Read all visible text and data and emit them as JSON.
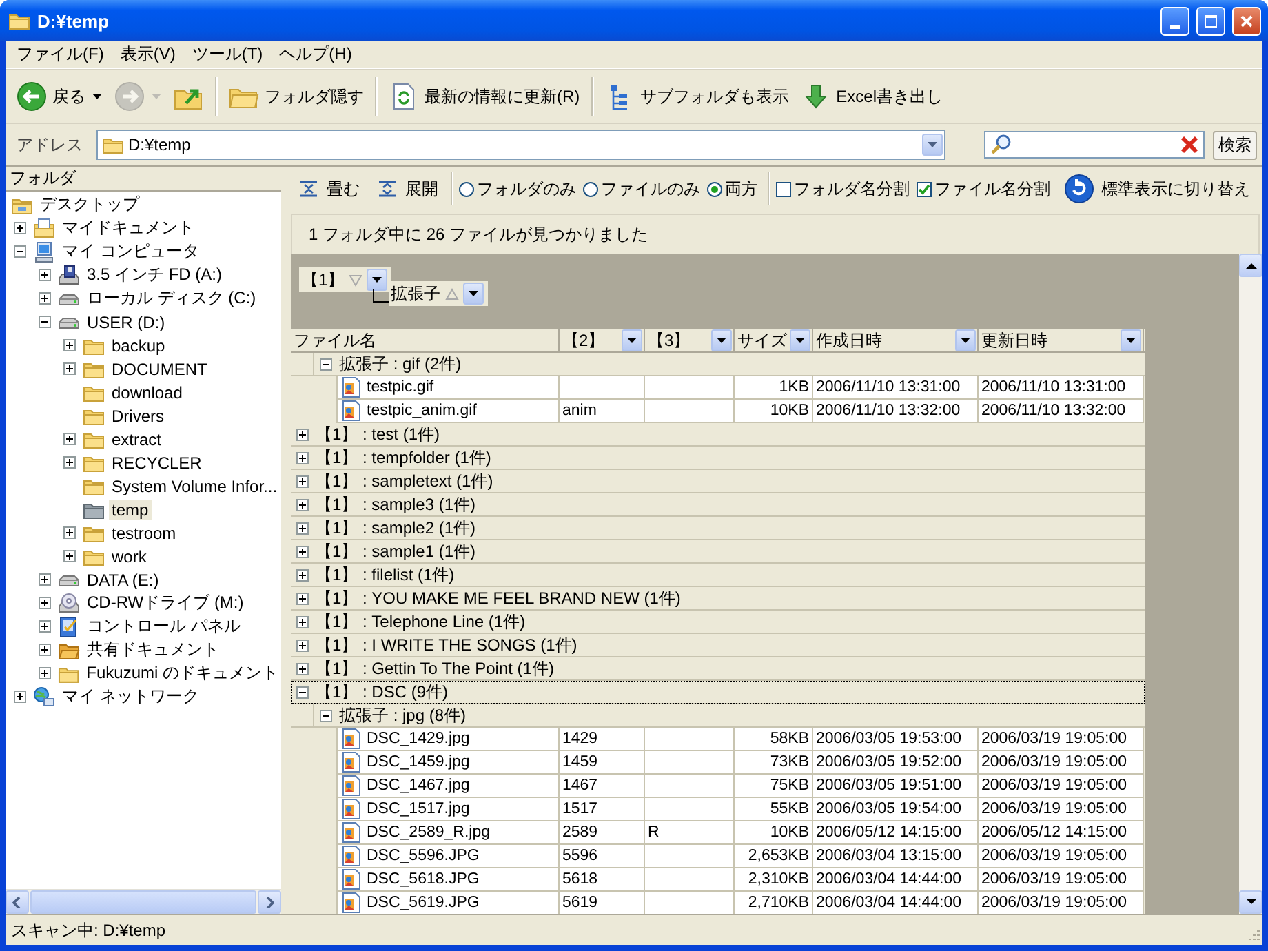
{
  "window": {
    "title": "D:¥temp"
  },
  "menu": [
    "ファイル(F)",
    "表示(V)",
    "ツール(T)",
    "ヘルプ(H)"
  ],
  "toolbar": [
    {
      "kind": "back",
      "label": "戻る",
      "dropdown": true,
      "disabled": false
    },
    {
      "kind": "forward",
      "dropdown": true,
      "disabled": true
    },
    {
      "kind": "up",
      "dropdown": false,
      "disabled": false
    },
    {
      "kind": "separator"
    },
    {
      "kind": "folders",
      "label": "フォルダ隠す",
      "dropdown": false,
      "disabled": false
    },
    {
      "kind": "separator"
    },
    {
      "kind": "refresh",
      "label": "最新の情報に更新(R)",
      "dropdown": false,
      "disabled": false
    },
    {
      "kind": "separator"
    },
    {
      "kind": "subfolders",
      "label": "サブフォルダも表示",
      "dropdown": false,
      "disabled": false
    },
    {
      "kind": "export",
      "label": "Excel書き出し",
      "dropdown": false,
      "disabled": false
    }
  ],
  "address": {
    "label": "アドレス",
    "value": "D:¥temp"
  },
  "search": {
    "button": "検索"
  },
  "folder_pane": {
    "title": "フォルダ",
    "tree": [
      {
        "label": "デスクトップ",
        "kind": "desktop",
        "selected": false,
        "children": [
          {
            "label": "マイドキュメント",
            "kind": "documents",
            "expanded": false,
            "selected": false
          },
          {
            "label": "マイ コンピュータ",
            "kind": "computer",
            "expanded": true,
            "selected": false,
            "children": [
              {
                "label": "3.5 インチ FD (A:)",
                "kind": "floppy",
                "expanded": false,
                "selected": false
              },
              {
                "label": "ローカル ディスク (C:)",
                "kind": "drive",
                "expanded": false,
                "selected": false
              },
              {
                "label": "USER (D:)",
                "kind": "drive",
                "expanded": true,
                "selected": false,
                "children": [
                  {
                    "label": "backup",
                    "kind": "folder",
                    "expanded": false,
                    "selected": false
                  },
                  {
                    "label": "DOCUMENT",
                    "kind": "folder",
                    "expanded": false,
                    "selected": false
                  },
                  {
                    "label": "download",
                    "kind": "folder",
                    "selected": false
                  },
                  {
                    "label": "Drivers",
                    "kind": "folder",
                    "selected": false
                  },
                  {
                    "label": "extract",
                    "kind": "folder",
                    "expanded": false,
                    "selected": false
                  },
                  {
                    "label": "RECYCLER",
                    "kind": "folder",
                    "expanded": false,
                    "selected": false
                  },
                  {
                    "label": "System Volume Infor...",
                    "kind": "folder",
                    "selected": false
                  },
                  {
                    "label": "temp",
                    "kind": "folder",
                    "selected": true
                  },
                  {
                    "label": "testroom",
                    "kind": "folder",
                    "expanded": false,
                    "selected": false
                  },
                  {
                    "label": "work",
                    "kind": "folder",
                    "expanded": false,
                    "selected": false
                  }
                ]
              },
              {
                "label": "DATA (E:)",
                "kind": "drive",
                "expanded": false,
                "selected": false
              },
              {
                "label": "CD-RWドライブ (M:)",
                "kind": "cdrom",
                "expanded": false,
                "selected": false
              },
              {
                "label": "コントロール パネル",
                "kind": "control-panel",
                "expanded": false,
                "selected": false
              },
              {
                "label": "共有ドキュメント",
                "kind": "shared",
                "expanded": false,
                "selected": false
              },
              {
                "label": "Fukuzumi のドキュメント",
                "kind": "folder",
                "expanded": false,
                "selected": false
              }
            ]
          },
          {
            "label": "マイ ネットワーク",
            "kind": "network",
            "expanded": false,
            "selected": false
          }
        ]
      }
    ]
  },
  "view_toolbar": {
    "actions": [
      {
        "kind": "collapse",
        "label": "畳む"
      },
      {
        "kind": "expand",
        "label": "展開"
      }
    ],
    "radios": [
      {
        "label": "フォルダのみ",
        "selected": false
      },
      {
        "label": "ファイルのみ",
        "selected": false
      },
      {
        "label": "両方",
        "selected": true
      }
    ],
    "checkboxes": [
      {
        "label": "フォルダ名分割",
        "checked": false
      },
      {
        "label": "ファイル名分割",
        "checked": true
      }
    ],
    "switch_button": "標準表示に切り替え"
  },
  "summary": "1 フォルダ中に 26 ファイルが見つかりました",
  "group_by": [
    {
      "label": "【1】",
      "descending": true
    },
    {
      "label": "拡張子",
      "descending": false
    }
  ],
  "grid": {
    "columns": [
      {
        "title": "ファイル名",
        "filter": false
      },
      {
        "title": "【2】",
        "filter": true
      },
      {
        "title": "【3】",
        "filter": true
      },
      {
        "title": "サイズ",
        "filter": true
      },
      {
        "title": "作成日時",
        "filter": true
      },
      {
        "title": "更新日時",
        "filter": true
      }
    ],
    "continued": [
      {
        "kind": "group",
        "label": "拡張子 : gif (2件)",
        "expanded": true,
        "focused": false,
        "children": [
          {
            "kind": "file",
            "name": "testpic.gif",
            "size": "1KB",
            "created": "2006/11/10 13:31:00",
            "modified": "2006/11/10 13:31:00"
          },
          {
            "kind": "file",
            "name": "testpic_anim.gif",
            "col2": "anim",
            "size": "10KB",
            "created": "2006/11/10 13:32:00",
            "modified": "2006/11/10 13:32:00"
          }
        ]
      }
    ],
    "rows": [
      {
        "kind": "group",
        "label": "【1】 : test (1件)",
        "expanded": false,
        "focused": false
      },
      {
        "kind": "group",
        "label": "【1】 : tempfolder (1件)",
        "expanded": false,
        "focused": false
      },
      {
        "kind": "group",
        "label": "【1】 : sampletext (1件)",
        "expanded": false,
        "focused": false
      },
      {
        "kind": "group",
        "label": "【1】 : sample3 (1件)",
        "expanded": false,
        "focused": false
      },
      {
        "kind": "group",
        "label": "【1】 : sample2 (1件)",
        "expanded": false,
        "focused": false
      },
      {
        "kind": "group",
        "label": "【1】 : sample1 (1件)",
        "expanded": false,
        "focused": false
      },
      {
        "kind": "group",
        "label": "【1】 : filelist (1件)",
        "expanded": false,
        "focused": false
      },
      {
        "kind": "group",
        "label": "【1】 : YOU MAKE ME FEEL BRAND NEW (1件)",
        "expanded": false,
        "focused": false
      },
      {
        "kind": "group",
        "label": "【1】 : Telephone Line (1件)",
        "expanded": false,
        "focused": false
      },
      {
        "kind": "group",
        "label": "【1】 : I WRITE THE SONGS (1件)",
        "expanded": false,
        "focused": false
      },
      {
        "kind": "group",
        "label": "【1】 : Gettin To The Point (1件)",
        "expanded": false,
        "focused": false
      },
      {
        "kind": "group",
        "label": "【1】 : DSC (9件)",
        "expanded": true,
        "focused": true,
        "children": [
          {
            "kind": "group",
            "label": "拡張子 : jpg (8件)",
            "expanded": true,
            "focused": false,
            "children": [
              {
                "kind": "file",
                "name": "DSC_1429.jpg",
                "col2": "1429",
                "size": "58KB",
                "created": "2006/03/05 19:53:00",
                "modified": "2006/03/19 19:05:00"
              },
              {
                "kind": "file",
                "name": "DSC_1459.jpg",
                "col2": "1459",
                "size": "73KB",
                "created": "2006/03/05 19:52:00",
                "modified": "2006/03/19 19:05:00"
              },
              {
                "kind": "file",
                "name": "DSC_1467.jpg",
                "col2": "1467",
                "size": "75KB",
                "created": "2006/03/05 19:51:00",
                "modified": "2006/03/19 19:05:00"
              },
              {
                "kind": "file",
                "name": "DSC_1517.jpg",
                "col2": "1517",
                "size": "55KB",
                "created": "2006/03/05 19:54:00",
                "modified": "2006/03/19 19:05:00"
              },
              {
                "kind": "file",
                "name": "DSC_2589_R.jpg",
                "col2": "2589",
                "col3": "R",
                "size": "10KB",
                "created": "2006/05/12 14:15:00",
                "modified": "2006/05/12 14:15:00"
              },
              {
                "kind": "file",
                "name": "DSC_5596.JPG",
                "col2": "5596",
                "size": "2,653KB",
                "created": "2006/03/04 13:15:00",
                "modified": "2006/03/19 19:05:00"
              },
              {
                "kind": "file",
                "name": "DSC_5618.JPG",
                "col2": "5618",
                "size": "2,310KB",
                "created": "2006/03/04 14:44:00",
                "modified": "2006/03/19 19:05:00"
              },
              {
                "kind": "file",
                "name": "DSC_5619.JPG",
                "col2": "5619",
                "size": "2,710KB",
                "created": "2006/03/04 14:44:00",
                "modified": "2006/03/19 19:05:00"
              }
            ]
          }
        ]
      }
    ]
  },
  "status_bar": "スキャン中: D:¥temp"
}
